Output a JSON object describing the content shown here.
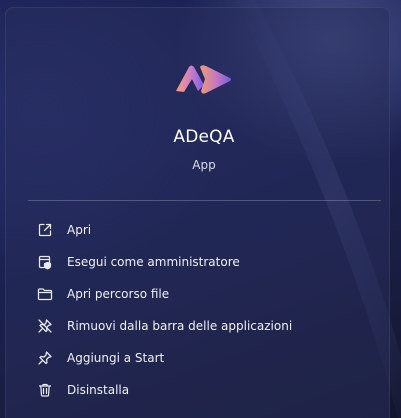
{
  "app": {
    "name": "ADeQA",
    "type": "App"
  },
  "menu": {
    "items": [
      {
        "label": "Apri",
        "icon": "open-external-icon"
      },
      {
        "label": "Esegui come amministratore",
        "icon": "run-as-admin-icon"
      },
      {
        "label": "Apri percorso file",
        "icon": "folder-icon"
      },
      {
        "label": "Rimuovi dalla barra delle applicazioni",
        "icon": "unpin-icon"
      },
      {
        "label": "Aggiungi a Start",
        "icon": "pin-icon"
      },
      {
        "label": "Disinstalla",
        "icon": "trash-icon"
      }
    ]
  },
  "colors": {
    "logo_gradient_start": "#f7a07a",
    "logo_gradient_mid": "#b56fd8",
    "logo_gradient_end": "#7b5cf0"
  }
}
